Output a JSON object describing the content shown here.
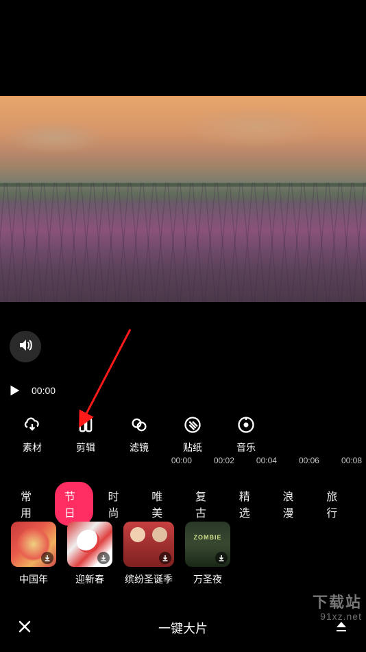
{
  "playback": {
    "current_time": "00:00"
  },
  "toolbar": [
    {
      "id": "material",
      "label": "素材"
    },
    {
      "id": "edit",
      "label": "剪辑"
    },
    {
      "id": "filter",
      "label": "滤镜"
    },
    {
      "id": "sticker",
      "label": "贴纸"
    },
    {
      "id": "music",
      "label": "音乐"
    }
  ],
  "timeline_marks": [
    "00:00",
    "00:02",
    "00:04",
    "00:06",
    "00:08"
  ],
  "tabs": [
    {
      "id": "common",
      "label": "常用",
      "active": false
    },
    {
      "id": "holiday",
      "label": "节日",
      "active": true
    },
    {
      "id": "fashion",
      "label": "时尚",
      "active": false
    },
    {
      "id": "beauty",
      "label": "唯美",
      "active": false
    },
    {
      "id": "retro",
      "label": "复古",
      "active": false
    },
    {
      "id": "featured",
      "label": "精选",
      "active": false
    },
    {
      "id": "romance",
      "label": "浪漫",
      "active": false
    },
    {
      "id": "travel",
      "label": "旅行",
      "active": false
    }
  ],
  "templates": [
    {
      "label": "中国年"
    },
    {
      "label": "迎新春"
    },
    {
      "label": "缤纷圣诞季"
    },
    {
      "label": "万圣夜"
    }
  ],
  "bottom": {
    "title": "一键大片"
  },
  "watermark": {
    "line1": "下载站",
    "line2": "91xz.net"
  }
}
